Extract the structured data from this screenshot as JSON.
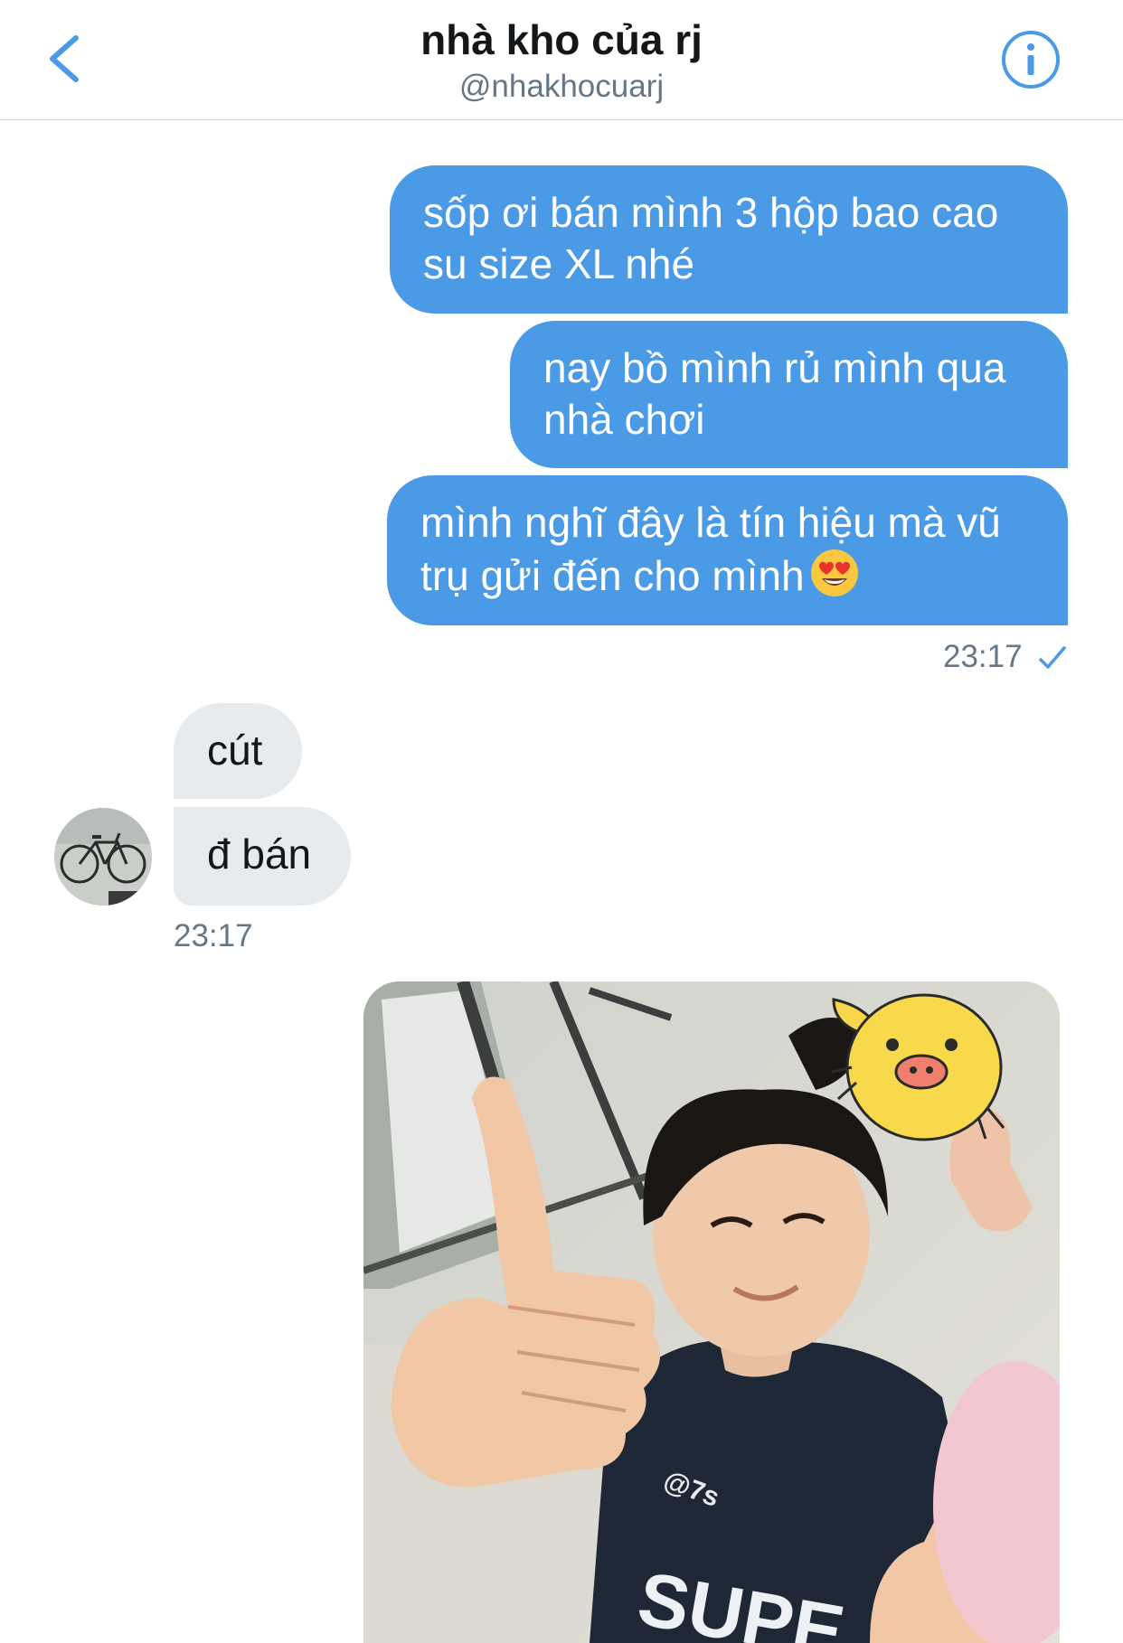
{
  "header": {
    "title": "nhà kho của rj",
    "handle": "@nhakhocuarj"
  },
  "messages": {
    "sent": [
      {
        "text": "sốp ơi bán mình 3 hộp bao cao su size XL nhé"
      },
      {
        "text": "nay bồ mình rủ mình qua nhà chơi"
      },
      {
        "text": "mình nghĩ đây là tín hiệu mà vũ trụ gửi đến cho mình",
        "emoji": "heart-eyes-emoji"
      }
    ],
    "sent_time": "23:17",
    "received": [
      {
        "text": "cút"
      },
      {
        "text": "đ bán"
      }
    ],
    "received_time": "23:17"
  },
  "image": {
    "shirt_text": "@7s",
    "shirt_word": "SUPE"
  },
  "colors": {
    "accent": "#4a9ae6",
    "received_bubble": "#e8ebee",
    "muted_text": "#657786"
  }
}
